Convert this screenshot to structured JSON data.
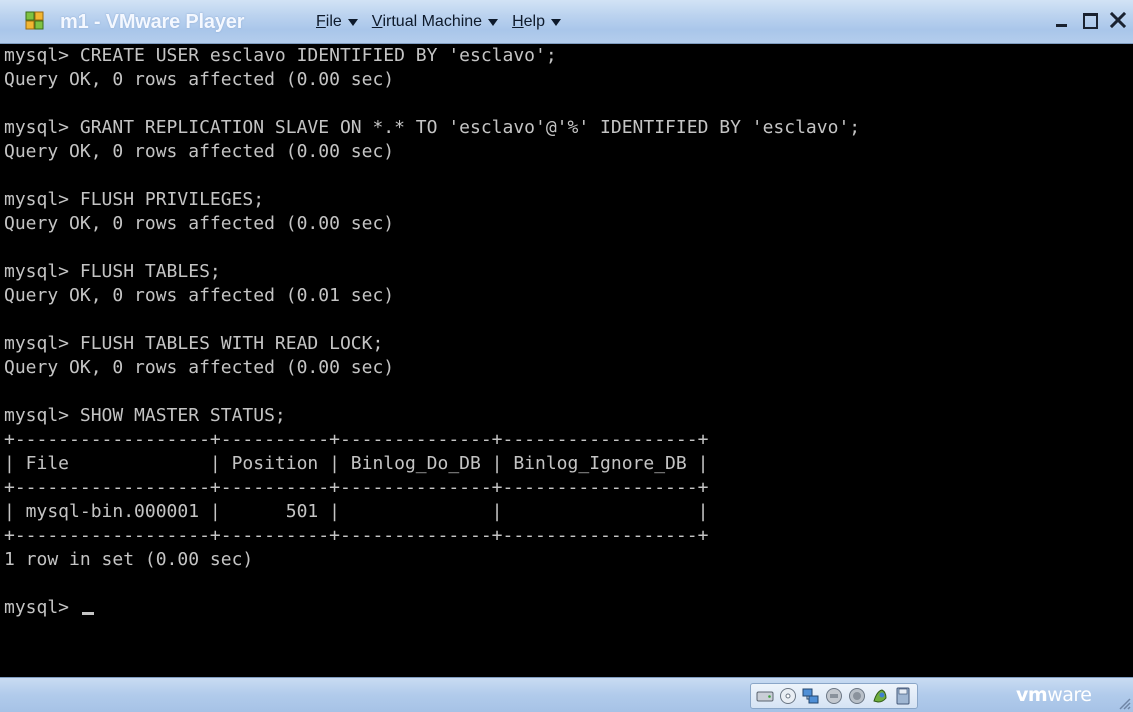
{
  "window": {
    "title": "m1 - VMware Player",
    "menus": [
      {
        "label": "File",
        "mnemonic": "F",
        "rest": "ile"
      },
      {
        "label": "Virtual Machine",
        "mnemonic": "V",
        "rest": "irtual Machine"
      },
      {
        "label": "Help",
        "mnemonic": "H",
        "rest": "elp"
      }
    ]
  },
  "console": {
    "lines": [
      "mysql> CREATE USER esclavo IDENTIFIED BY 'esclavo';",
      "Query OK, 0 rows affected (0.00 sec)",
      "",
      "mysql> GRANT REPLICATION SLAVE ON *.* TO 'esclavo'@'%' IDENTIFIED BY 'esclavo';",
      "Query OK, 0 rows affected (0.00 sec)",
      "",
      "mysql> FLUSH PRIVILEGES;",
      "Query OK, 0 rows affected (0.00 sec)",
      "",
      "mysql> FLUSH TABLES;",
      "Query OK, 0 rows affected (0.01 sec)",
      "",
      "mysql> FLUSH TABLES WITH READ LOCK;",
      "Query OK, 0 rows affected (0.00 sec)",
      "",
      "mysql> SHOW MASTER STATUS;",
      "+------------------+----------+--------------+------------------+",
      "| File             | Position | Binlog_Do_DB | Binlog_Ignore_DB |",
      "+------------------+----------+--------------+------------------+",
      "| mysql-bin.000001 |      501 |              |                  |",
      "+------------------+----------+--------------+------------------+",
      "1 row in set (0.00 sec)",
      ""
    ],
    "prompt": "mysql> "
  },
  "statusbar": {
    "devices": [
      "hard-disk-icon",
      "cd-rom-icon",
      "network-adapter-icon",
      "usb-controller-icon",
      "sound-card-icon",
      "printer-icon",
      "floppy-icon"
    ],
    "brand_bold": "vm",
    "brand_rest": "ware"
  },
  "colors": {
    "console_bg": "#000000",
    "console_text": "#c4c4c4",
    "titlebar": "#bcd3ef",
    "statusbar": "#b1cbeb"
  }
}
